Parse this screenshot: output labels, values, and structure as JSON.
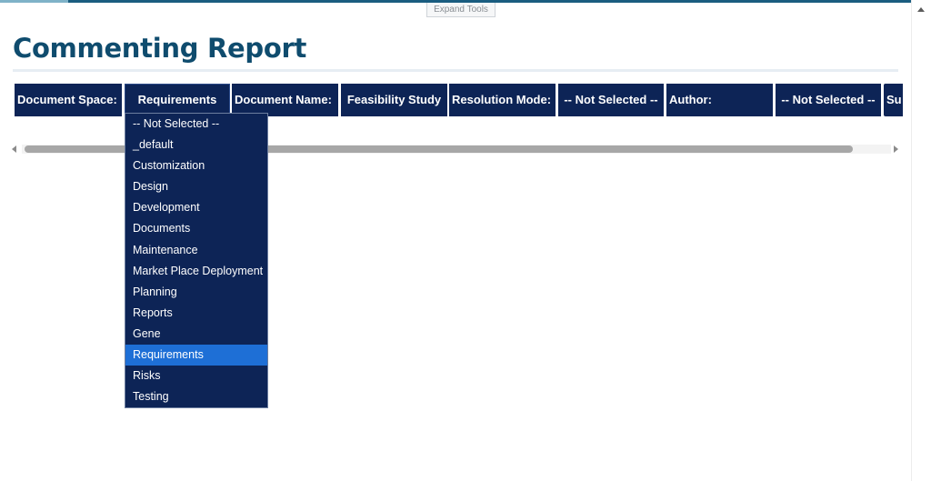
{
  "toolbar": {
    "expand_tools_label": "Expand Tools"
  },
  "page": {
    "title": "Commenting Report"
  },
  "filters": {
    "document_space_label": "Document Space:",
    "document_space_value": "Requirements",
    "document_name_label": "Document Name:",
    "document_name_value": "Feasibility Study",
    "resolution_mode_label": "Resolution Mode:",
    "resolution_mode_value": "-- Not Selected --",
    "author_label": "Author:",
    "author_value": "-- Not Selected --",
    "next_label_partial": "Su"
  },
  "document_space_dropdown": {
    "selected": "Requirements",
    "options": [
      "-- Not Selected --",
      "_default",
      "Customization",
      "Design",
      "Development",
      "Documents",
      "Maintenance",
      "Market Place Deployment",
      "Planning",
      "Reports",
      "Gene",
      "Requirements",
      "Risks",
      "Testing"
    ]
  },
  "colors": {
    "title": "#0f4c6e",
    "filter_bg": "#0d2456",
    "selected_option": "#1e6fd6"
  }
}
